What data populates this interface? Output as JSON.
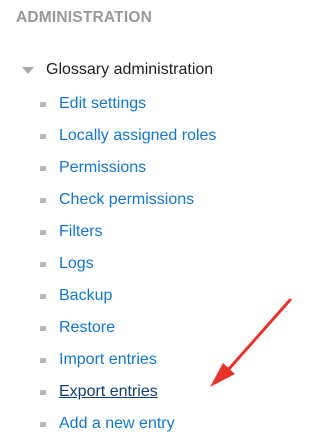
{
  "admin": {
    "section_title": "ADMINISTRATION",
    "tree_label": "Glossary administration",
    "items": [
      {
        "label": "Edit settings"
      },
      {
        "label": "Locally assigned roles"
      },
      {
        "label": "Permissions"
      },
      {
        "label": "Check permissions"
      },
      {
        "label": "Filters"
      },
      {
        "label": "Logs"
      },
      {
        "label": "Backup"
      },
      {
        "label": "Restore"
      },
      {
        "label": "Import entries"
      },
      {
        "label": "Export entries"
      },
      {
        "label": "Add a new entry"
      }
    ]
  },
  "colors": {
    "link": "#1177d1",
    "highlighted_link": "#0f3e70",
    "annotation_arrow": "#e8332a",
    "section_title": "#999999"
  },
  "icons": {
    "tree_toggle": "caret-down-icon",
    "list_bullet": "bullet-icon",
    "annotation": "red-arrow-icon"
  }
}
